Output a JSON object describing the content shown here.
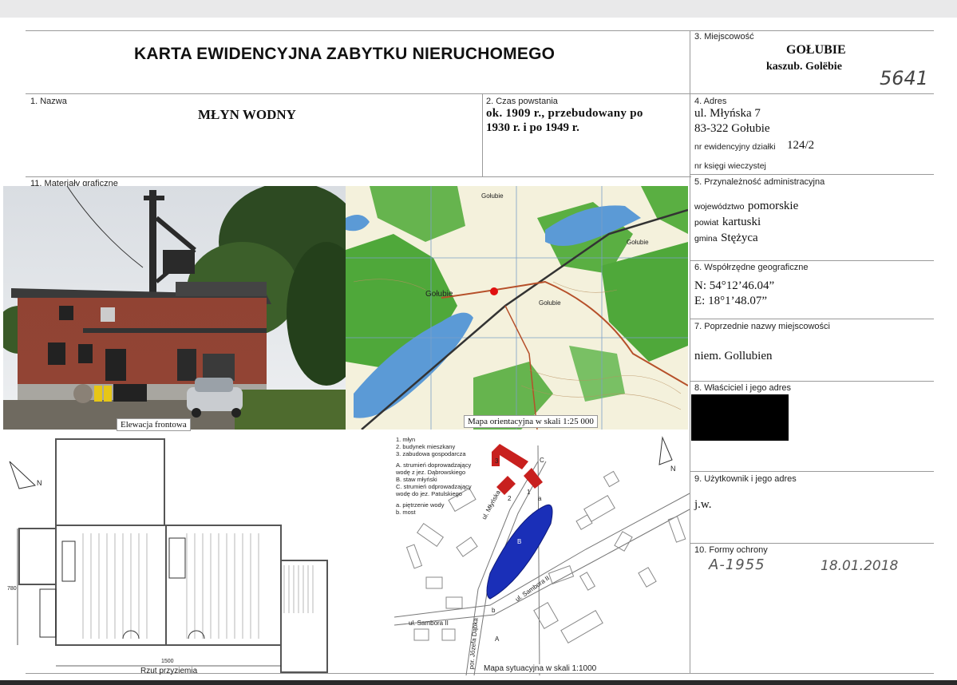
{
  "header": {
    "title": "KARTA EWIDENCYJNA ZABYTKU NIERUCHOMEGO",
    "stamp_number": "5641"
  },
  "sections": {
    "miejscowosc": {
      "label": "3. Miejscowość",
      "name": "GOŁUBIE",
      "kashubian": "kaszub. Golëbie"
    },
    "nazwa": {
      "label": "1. Nazwa",
      "value": "MŁYN WODNY"
    },
    "czas": {
      "label": "2. Czas powstania",
      "line1": "ok. 1909 r., przebudowany po",
      "line2": "1930 r. i po 1949 r."
    },
    "adres": {
      "label": "4. Adres",
      "street": "ul. Młyńska 7",
      "postal": "83-322 Gołubie",
      "plot_label": "nr ewidencyjny działki",
      "plot_value": "124/2",
      "book_label": "nr księgi wieczystej"
    },
    "materialy": {
      "label": "11. Materiały graficzne"
    },
    "przynaleznosc": {
      "label": "5. Przynależność administracyjna",
      "wojewodztwo_label": "województwo",
      "wojewodztwo": "pomorskie",
      "powiat_label": "powiat",
      "powiat": "kartuski",
      "gmina_label": "gmina",
      "gmina": "Stężyca"
    },
    "wspolrzedne": {
      "label": "6. Współrzędne geograficzne",
      "n": "N: 54°12’46.04”",
      "e": "E: 18°1’48.07”"
    },
    "poprzednie": {
      "label": "7. Poprzednie nazwy miejscowości",
      "value": "niem. Gollubien"
    },
    "wlasciciel": {
      "label": "8. Właściciel i jego adres"
    },
    "uzytkownik": {
      "label": "9. Użytkownik i jego adres",
      "value": "j.w."
    },
    "formy": {
      "label": "10. Formy ochrony",
      "register": "A-1955",
      "date": "18.01.2018"
    }
  },
  "graphics": {
    "photo_caption": "Elewacja frontowa",
    "map_caption": "Mapa orientacyjna w skali 1:25 000",
    "map_labels": [
      "Gołubie",
      "Gołubie",
      "Gołubie",
      "Gołubie"
    ],
    "plan_caption": "Rzut przyziemia",
    "plan_dim_width": "1500",
    "plan_dim_height": "780",
    "north": "N",
    "site_caption": "Mapa sytuacyjna w skali 1:1000",
    "site_legend": [
      "1. młyn",
      "2. budynek mieszkany",
      "3. zabudowa gospodarcza",
      "",
      "A. strumień doprowadzający",
      "wodę z jez. Dąbrowskiego",
      "B. staw młyński",
      "C. strumień odprowadzający",
      "wodę do jez. Patulskiego",
      "",
      "a. piętrzenie wody",
      "b. most"
    ],
    "street_labels": [
      "ul. Młyńska",
      "ul. Sambora II",
      "ul. Sambora II",
      "por. Józefa Dąbka"
    ],
    "site_letters": [
      "1",
      "2",
      "3",
      "A",
      "B",
      "C",
      "a",
      "b"
    ]
  },
  "colors": {
    "border": "#9a9a9a",
    "building_red": "#c8201e",
    "pond_blue": "#1a2fb8",
    "map_green": "#4fa83a",
    "map_water": "#5b9ad6"
  }
}
